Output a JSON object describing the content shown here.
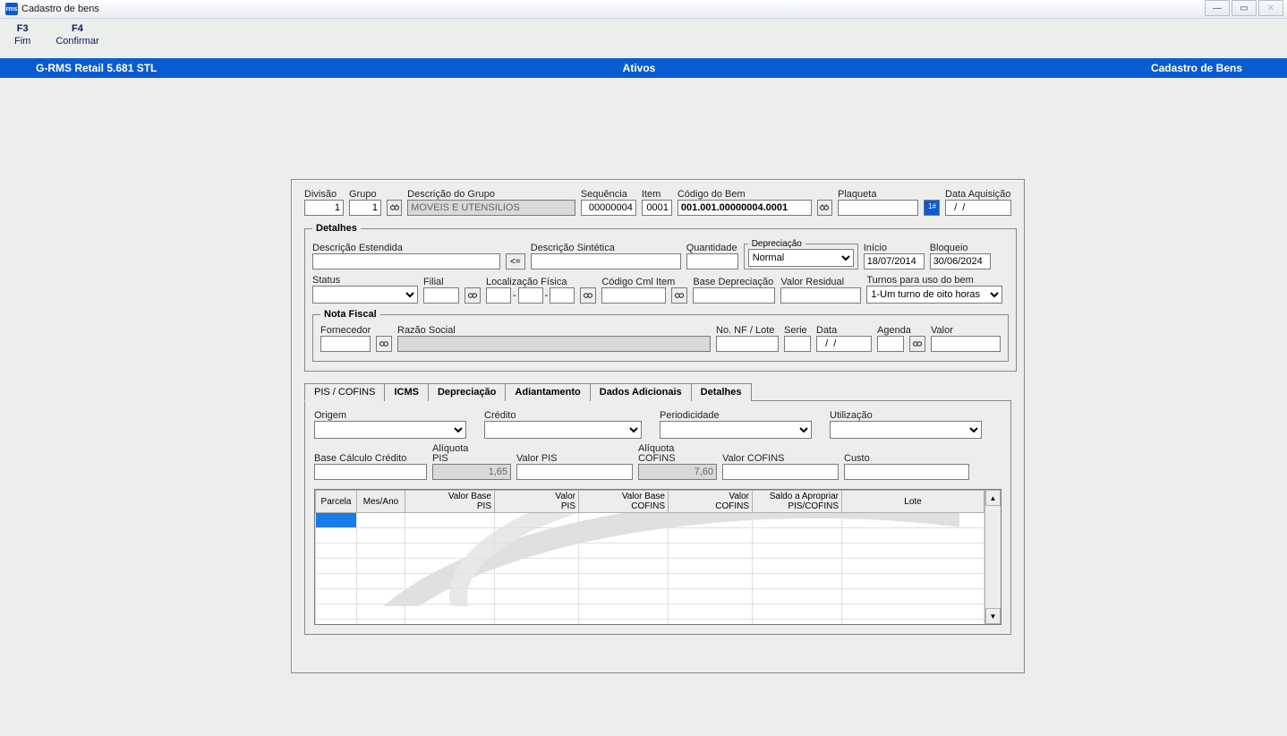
{
  "window": {
    "title": "Cadastro de bens",
    "app_icon_text": "rms"
  },
  "menu": {
    "f3": "F3",
    "fim": "Fim",
    "f4": "F4",
    "confirmar": "Confirmar"
  },
  "bluebar": {
    "left": "G-RMS Retail 5.681 STL",
    "center": "Ativos",
    "right": "Cadastro de Bens"
  },
  "top": {
    "divisao_label": "Divisão",
    "divisao": "1",
    "grupo_label": "Grupo",
    "grupo": "1",
    "descgrupo_label": "Descrição do Grupo",
    "descgrupo": "MOVEIS E UTENSILIOS",
    "seq_label": "Sequência",
    "seq": "00000004",
    "item_label": "Item",
    "item": "0001",
    "codbem_label": "Código do Bem",
    "codbem": "001.001.00000004.0001",
    "plaqueta_label": "Plaqueta",
    "plaqueta": "",
    "dataaq_label": "Data Aquisição",
    "dataaq": "  /  /"
  },
  "detalhes": {
    "legend": "Detalhes",
    "descest_label": "Descrição Estendida",
    "descest": "",
    "copy_btn": "<=",
    "descsin_label": "Descrição Sintética",
    "descsin": "",
    "qtd_label": "Quantidade",
    "qtd": "",
    "dep_legend": "Depreciação",
    "dep_value": "Normal",
    "inicio_label": "Início",
    "inicio": "18/07/2014",
    "bloqueio_label": "Bloqueio",
    "bloqueio": "30/06/2024",
    "status_label": "Status",
    "status": "",
    "filial_label": "Filial",
    "filial": "",
    "locfis_label": "Localização Física",
    "codcml_label": "Código Cml Item",
    "codcml": "",
    "basedep_label": "Base Depreciação",
    "basedep": "",
    "vresid_label": "Valor Residual",
    "vresid": "",
    "turnos_label": "Turnos para uso do bem",
    "turnos": "1-Um turno de oito horas"
  },
  "nf": {
    "legend": "Nota Fiscal",
    "forn_label": "Fornecedor",
    "forn": "",
    "razao_label": "Razão Social",
    "razao": "",
    "nflote_label": "No. NF / Lote",
    "nflote": "",
    "serie_label": "Serie",
    "serie": "",
    "data_label": "Data",
    "data": "  /  /",
    "agenda_label": "Agenda",
    "agenda": "",
    "valor_label": "Valor",
    "valor": ""
  },
  "tabs": {
    "pis": "PIS / COFINS",
    "icms": "ICMS",
    "dep": "Depreciação",
    "adi": "Adiantamento",
    "dados": "Dados Adicionais",
    "det": "Detalhes"
  },
  "pis": {
    "origem_label": "Origem",
    "credito_label": "Crédito",
    "period_label": "Periodicidade",
    "util_label": "Utilização",
    "basecalc_label": "Base Cálculo Crédito",
    "basecalc": "",
    "aliqpis_label": "Alíquota PIS",
    "aliqpis": "1,65",
    "valorpis_label": "Valor PIS",
    "valorpis": "",
    "aliqcof_label": "Alíquota COFINS",
    "aliqcof": "7,60",
    "valorcof_label": "Valor COFINS",
    "valorcof": "",
    "custo_label": "Custo",
    "custo": ""
  },
  "grid": {
    "h_parcela": "Parcela",
    "h_mesano": "Mes/Ano",
    "h_vbpis": "Valor Base PIS",
    "h_vpis": "Valor PIS",
    "h_vbcof": "Valor Base COFINS",
    "h_vcof": "Valor COFINS",
    "h_saldo": "Saldo a Apropriar PIS/COFINS",
    "h_lote": "Lote"
  }
}
